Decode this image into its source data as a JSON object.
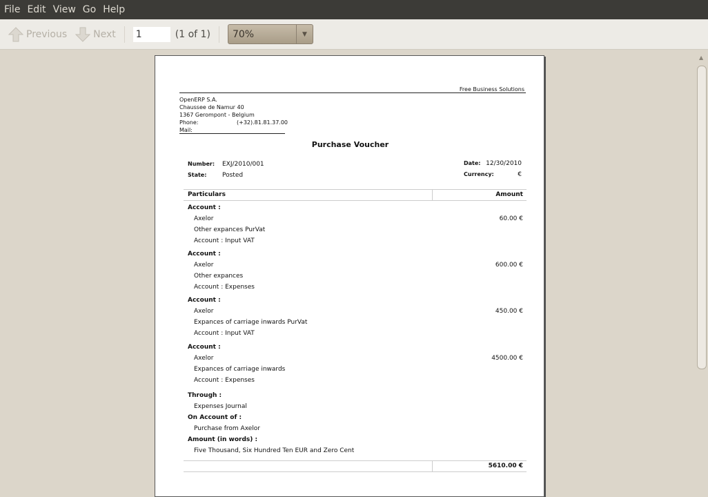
{
  "menu": [
    "File",
    "Edit",
    "View",
    "Go",
    "Help"
  ],
  "toolbar": {
    "previous": "Previous",
    "next": "Next",
    "page_value": "1",
    "page_count": "(1 of 1)",
    "zoom": "70%"
  },
  "doc": {
    "tagline": "Free Business Solutions",
    "company": [
      "OpenERP S.A.",
      "Chaussee de Namur 40",
      "1367 Gerompont - Belgium"
    ],
    "phone_label": "Phone:",
    "phone": "(+32).81.81.37.00",
    "mail_label": "Mail:",
    "title": "Purchase Voucher",
    "number_label": "Number:",
    "number": "EXJ/2010/001",
    "state_label": "State:",
    "state": "Posted",
    "date_label": "Date:",
    "date": "12/30/2010",
    "currency_label": "Currency:",
    "currency": "€",
    "col_particulars": "Particulars",
    "col_amount": "Amount",
    "entries": [
      {
        "label": "Account :",
        "partner": "Axelor",
        "amount": "60.00 €",
        "desc": "Other expances PurVat",
        "account": "Account : Input VAT"
      },
      {
        "label": "Account :",
        "partner": "Axelor",
        "amount": "600.00 €",
        "desc": "Other expances",
        "account": "Account : Expenses"
      },
      {
        "label": "Account :",
        "partner": "Axelor",
        "amount": "450.00 €",
        "desc": "Expances of carriage inwards PurVat",
        "account": "Account : Input VAT"
      },
      {
        "label": "Account :",
        "partner": "Axelor",
        "amount": "4500.00 €",
        "desc": "Expances of carriage inwards",
        "account": "Account : Expenses"
      }
    ],
    "through_label": "Through :",
    "through": "Expenses Journal",
    "on_account_label": "On Account of :",
    "on_account": "Purchase from Axelor",
    "words_label": "Amount (in words) :",
    "words": "Five Thousand, Six Hundred Ten EUR and Zero Cent",
    "total": "5610.00 €"
  }
}
